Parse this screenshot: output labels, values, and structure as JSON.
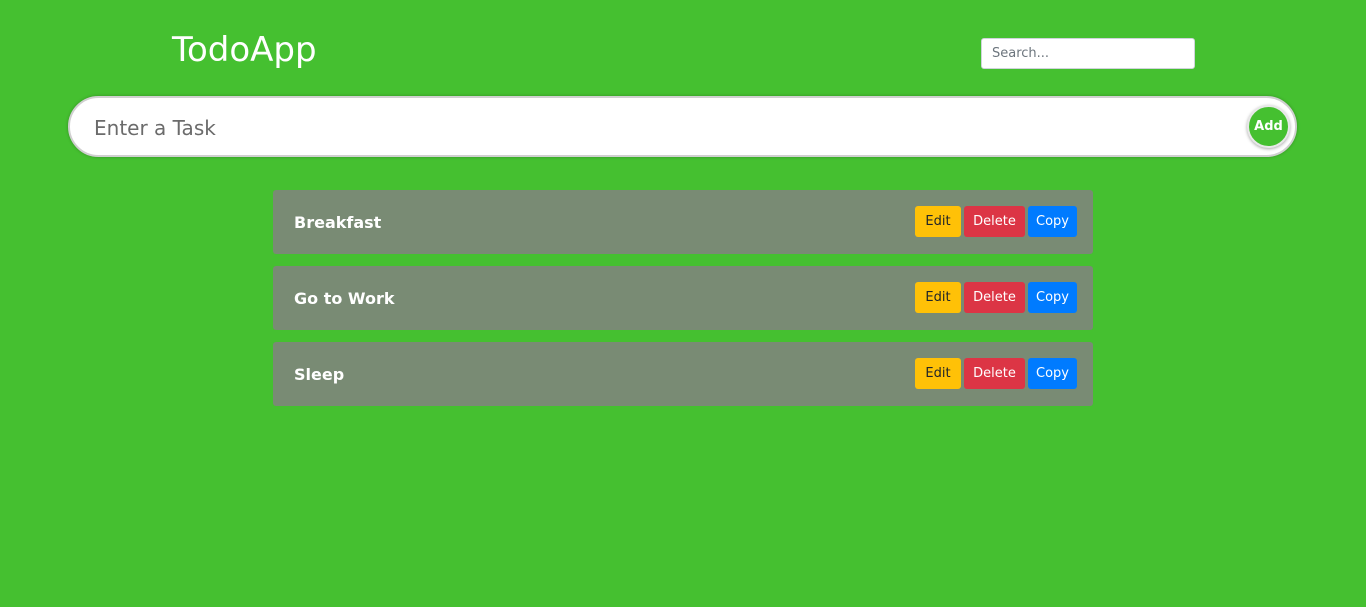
{
  "app": {
    "title": "TodoApp",
    "background_color": "#45c030"
  },
  "search": {
    "placeholder": "Search...",
    "value": ""
  },
  "task_input": {
    "placeholder": "Enter a Task",
    "value": "",
    "add_label": "Add"
  },
  "tasks": [
    {
      "text": "Breakfast",
      "edit_label": "Edit",
      "delete_label": "Delete",
      "copy_label": "Copy"
    },
    {
      "text": "Go to Work",
      "edit_label": "Edit",
      "delete_label": "Delete",
      "copy_label": "Copy"
    },
    {
      "text": "Sleep",
      "edit_label": "Edit",
      "delete_label": "Delete",
      "copy_label": "Copy"
    }
  ],
  "colors": {
    "edit": "#ffc107",
    "delete": "#dc3545",
    "copy": "#007bff",
    "task_card": "#798b74"
  }
}
